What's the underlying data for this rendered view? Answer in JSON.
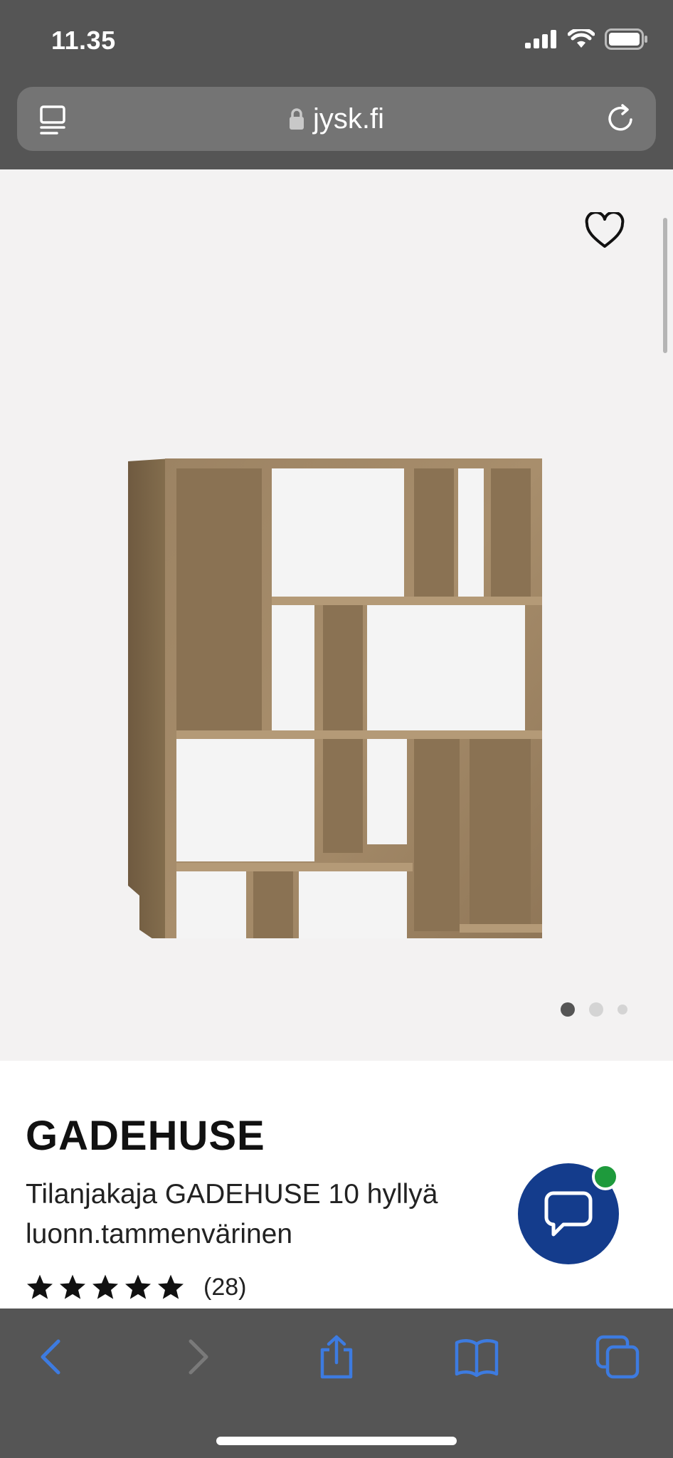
{
  "status": {
    "time": "11.35"
  },
  "browser": {
    "url": "jysk.fi"
  },
  "product": {
    "brand": "GADEHUSE",
    "description": "Tilanjakaja GADEHUSE 10 hyllyä luonn.tammenvärinen",
    "rating": 5,
    "rating_count": "(28)",
    "gallery_images": 3,
    "gallery_active_index": 0
  },
  "colors": {
    "chrome": "#555555",
    "gallery_bg": "#f3f2f2",
    "chat_button": "#143c8c",
    "chat_badge": "#1e9a3c",
    "toolbar_icon_active": "#3d7be0",
    "toolbar_icon_disabled": "#7a7a7a"
  },
  "icons": {
    "favorite": "heart-outline-icon",
    "chat": "speech-bubble-icon",
    "back": "chevron-left-icon",
    "forward": "chevron-right-icon",
    "share": "share-icon",
    "bookmarks": "book-icon",
    "tabs": "tabs-icon",
    "reader": "reader-icon",
    "reload": "reload-icon",
    "lock": "lock-icon"
  }
}
